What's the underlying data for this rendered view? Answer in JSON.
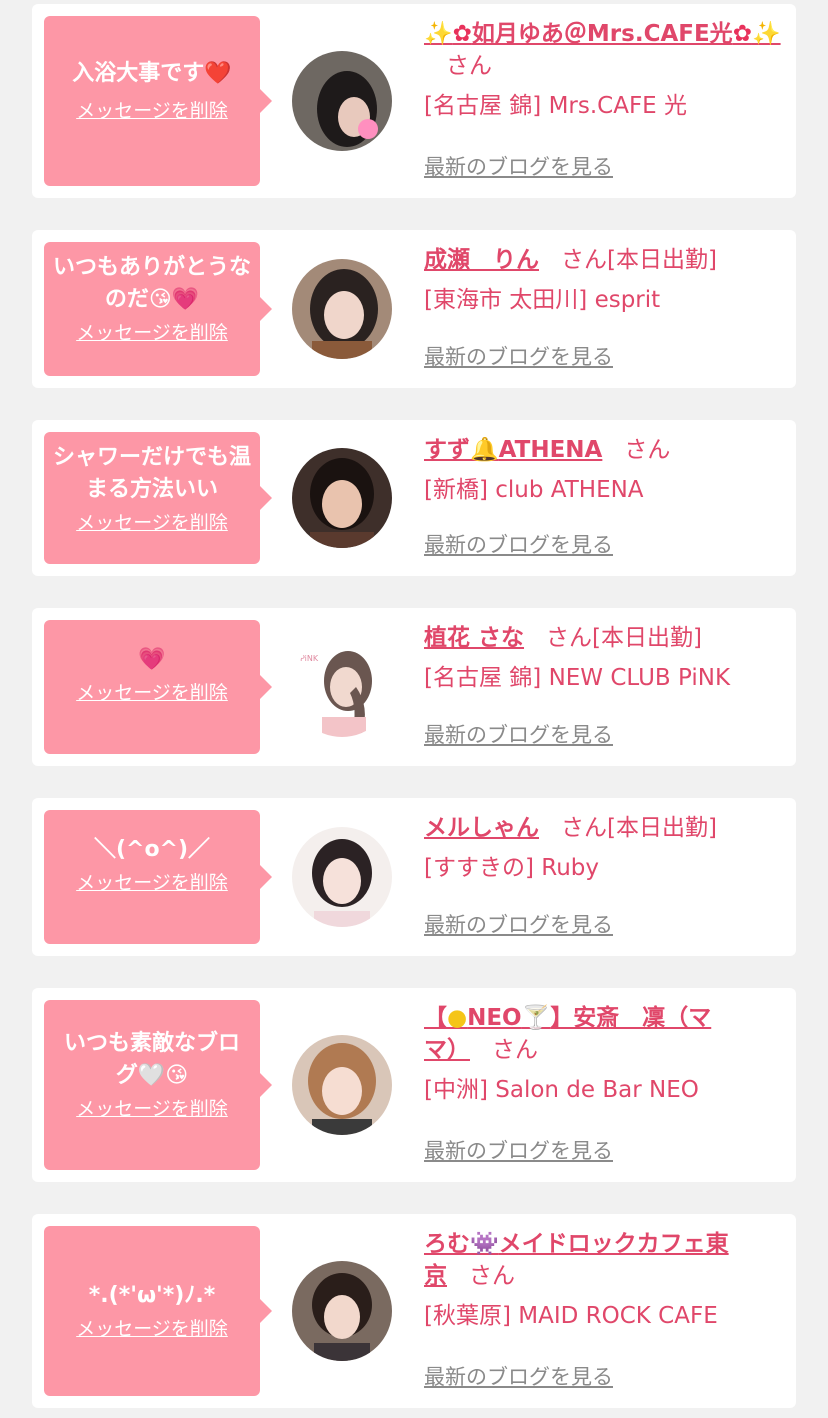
{
  "delete_label": "メッセージを削除",
  "blog_label": "最新のブログを見る",
  "san_label": "さん",
  "colors": {
    "bubble": "#fd97a6",
    "accent": "#e0476a",
    "link_gray": "#8a8a8a",
    "background": "#f1f1f1"
  },
  "messages": [
    {
      "message": "入浴大事です❤️",
      "name_parts": [
        "sparkles-icon",
        "hibiscus-icon",
        "如月ゆあ＠Mrs.CAFE光",
        "hibiscus-icon",
        "sparkles-icon"
      ],
      "name_text": "如月ゆあ＠Mrs.CAFE光",
      "status": "",
      "shop": "[名古屋 錦] Mrs.CAFE 光",
      "avatar_icon": "profile-photo"
    },
    {
      "message": "いつもありがとうなのだ😘💗",
      "name_text": "成瀬　りん",
      "status": "[本日出勤]",
      "shop": "[東海市 太田川] esprit",
      "avatar_icon": "profile-photo"
    },
    {
      "message": "シャワーだけでも温まる方法いい",
      "name_text_a": "すず",
      "name_text_b": "ATHENA",
      "status": "",
      "shop": "[新橋] club ATHENA",
      "avatar_icon": "profile-photo"
    },
    {
      "message": "💗",
      "name_text": "植花 さな",
      "status": "[本日出勤]",
      "shop": "[名古屋 錦] NEW CLUB PiNK",
      "avatar_icon": "profile-photo"
    },
    {
      "message": "＼(^o^)／",
      "name_text": "メルしゃん",
      "status": "[本日出勤]",
      "shop": "[すすきの] Ruby",
      "avatar_icon": "profile-photo"
    },
    {
      "message_a": "いつも素敵なブロ",
      "message_b": "グ🤍😘",
      "name_text_a": "【",
      "name_text_b": "NEO",
      "name_text_c": "】安斎　凜（マ",
      "name_text_d": "マ）",
      "status": "",
      "shop": "[中洲] Salon de Bar NEO",
      "avatar_icon": "profile-photo"
    },
    {
      "message": "*.(*'ω'*)ﾉ.*",
      "name_text_a": "ろむ",
      "name_text_b": "メイドロックカフェ東",
      "name_text_c": "京",
      "status": "",
      "shop": "[秋葉原] MAID ROCK CAFE",
      "avatar_icon": "profile-photo"
    }
  ]
}
